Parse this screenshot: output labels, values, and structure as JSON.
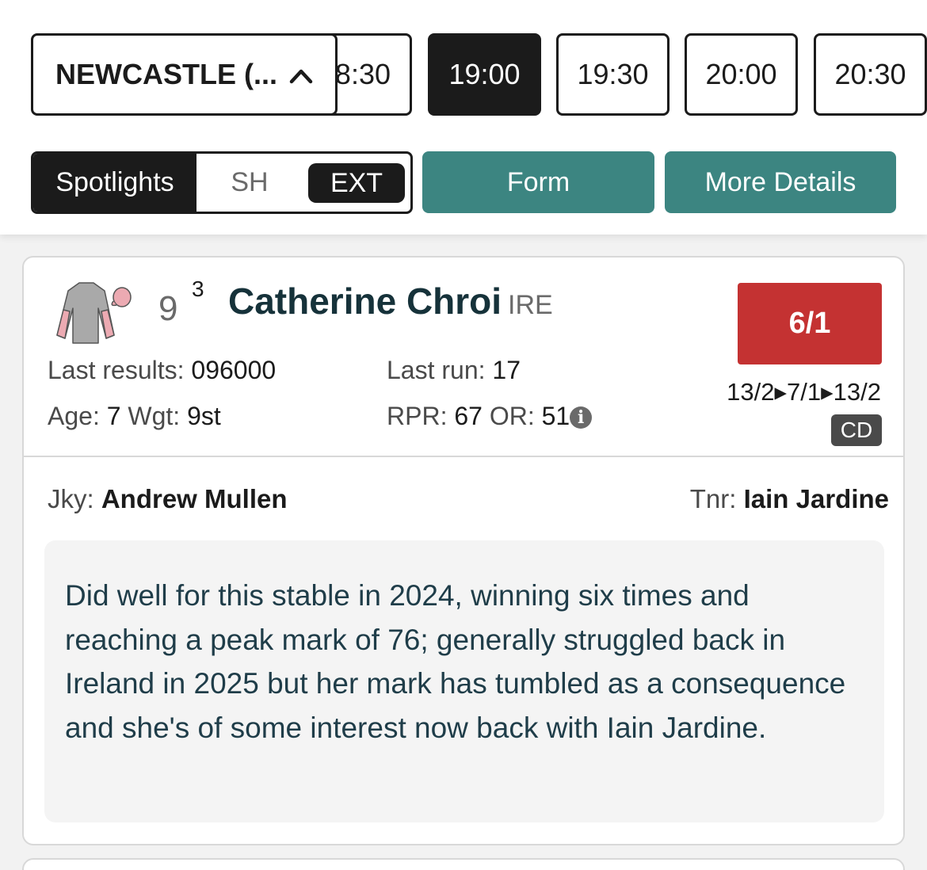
{
  "race_nav": {
    "venue": "NEWCASTLE (...",
    "times": [
      {
        "label": "8:30",
        "active": false
      },
      {
        "label": "19:00",
        "active": true
      },
      {
        "label": "19:30",
        "active": false
      },
      {
        "label": "20:00",
        "active": false
      },
      {
        "label": "20:30",
        "active": false
      }
    ]
  },
  "view_toggle": {
    "options": [
      "Spotlights",
      "SH",
      "EXT"
    ],
    "selected": "Spotlights"
  },
  "actions": {
    "form_label": "Form",
    "more_details_label": "More Details"
  },
  "runner": {
    "saddle_number": "9",
    "draw": "3",
    "name": "Catherine Chroi",
    "country": "IRE",
    "silks": {
      "body": "#a9a9a9",
      "sleeves": "#ecaab2",
      "cap": "#ecaab2"
    },
    "odds": "6/1",
    "odds_movement": "13/2▸7/1▸13/2",
    "badge": "CD",
    "last_results_label": "Last results:",
    "last_results": "096000",
    "last_run_label": "Last run:",
    "last_run": "17",
    "age_label": "Age:",
    "age": "7",
    "weight_label": "Wgt:",
    "weight": "9st",
    "rpr_label": "RPR:",
    "rpr": "67",
    "or_label": "OR:",
    "or": "51",
    "info_icon": "i",
    "jockey_label": "Jky:",
    "jockey": "Andrew Mullen",
    "trainer_label": "Tnr:",
    "trainer": "Iain Jardine",
    "comment": "Did well for this stable in 2024, winning six times and reaching a peak mark of 76; generally struggled back in Ireland in 2025 but her mark has tumbled as a consequence and she's of some interest now back with Iain Jardine."
  },
  "colors": {
    "teal": "#3c8581",
    "odds_red": "#c43232",
    "dark": "#1b1b1b",
    "comment_text": "#1f3d49"
  }
}
